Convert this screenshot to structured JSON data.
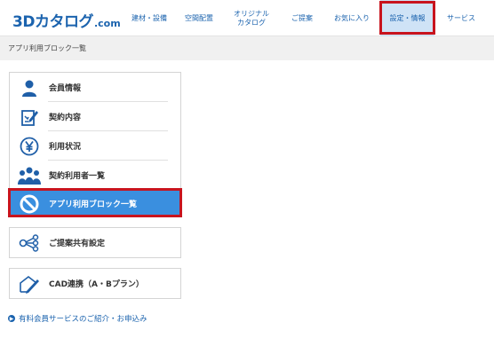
{
  "header": {
    "logo_main": "3Dカタログ",
    "logo_sub": ".com",
    "nav": [
      {
        "label": "建材・設備"
      },
      {
        "label": "空間配置"
      },
      {
        "label": "オリジナル\nカタログ"
      },
      {
        "label": "ご提案"
      },
      {
        "label": "お気に入り"
      },
      {
        "label": "設定・情報",
        "active": true
      },
      {
        "label": "サービス"
      }
    ]
  },
  "breadcrumb": "アプリ利用ブロック一覧",
  "menu": {
    "group1": [
      {
        "label": "会員情報",
        "icon": "user-icon"
      },
      {
        "label": "契約内容",
        "icon": "contract-edit-icon"
      },
      {
        "label": "利用状況",
        "icon": "yen-circle-icon"
      },
      {
        "label": "契約利用者一覧",
        "icon": "users-group-icon"
      },
      {
        "label": "アプリ利用ブロック一覧",
        "icon": "prohibited-icon",
        "selected": true
      }
    ],
    "group2": [
      {
        "label": "ご提案共有設定",
        "icon": "share-icon"
      }
    ],
    "group3": [
      {
        "label": "CAD連携（A・Bプラン）",
        "icon": "cad-pencil-icon"
      }
    ]
  },
  "footer_link": "有料会員サービスのご紹介・お申込み",
  "colors": {
    "brand": "#1b63ae",
    "selected": "#3a8fdf",
    "highlight": "#c8141e",
    "icon": "#1f5fa8"
  }
}
